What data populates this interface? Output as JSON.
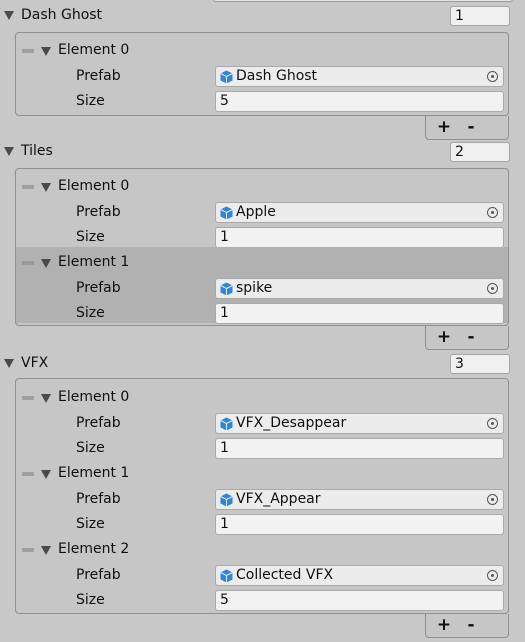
{
  "lists": [
    {
      "label": "Dash Ghost",
      "count": "1",
      "elements": [
        {
          "label": "Element 0",
          "prefab_label": "Prefab",
          "prefab": "Dash Ghost",
          "size_label": "Size",
          "size": "5"
        }
      ]
    },
    {
      "label": "Tiles",
      "count": "2",
      "elements": [
        {
          "label": "Element 0",
          "prefab_label": "Prefab",
          "prefab": "Apple",
          "size_label": "Size",
          "size": "1"
        },
        {
          "label": "Element 1",
          "prefab_label": "Prefab",
          "prefab": "spike",
          "size_label": "Size",
          "size": "1"
        }
      ]
    },
    {
      "label": "VFX",
      "count": "3",
      "elements": [
        {
          "label": "Element 0",
          "prefab_label": "Prefab",
          "prefab": "VFX_Desappear",
          "size_label": "Size",
          "size": "1"
        },
        {
          "label": "Element 1",
          "prefab_label": "Prefab",
          "prefab": "VFX_Appear",
          "size_label": "Size",
          "size": "1"
        },
        {
          "label": "Element 2",
          "prefab_label": "Prefab",
          "prefab": "Collected VFX",
          "size_label": "Size",
          "size": "5"
        }
      ]
    }
  ],
  "footer": {
    "add_label": "+",
    "remove_label": "-"
  },
  "colors": {
    "prefab_icon": "#2f86d6",
    "selected_row": "#b1b1b1"
  },
  "icons": {
    "prefab": "prefab-cube-icon",
    "picker": "object-picker-icon",
    "foldout": "foldout-arrow-icon",
    "drag": "drag-handle-icon"
  }
}
